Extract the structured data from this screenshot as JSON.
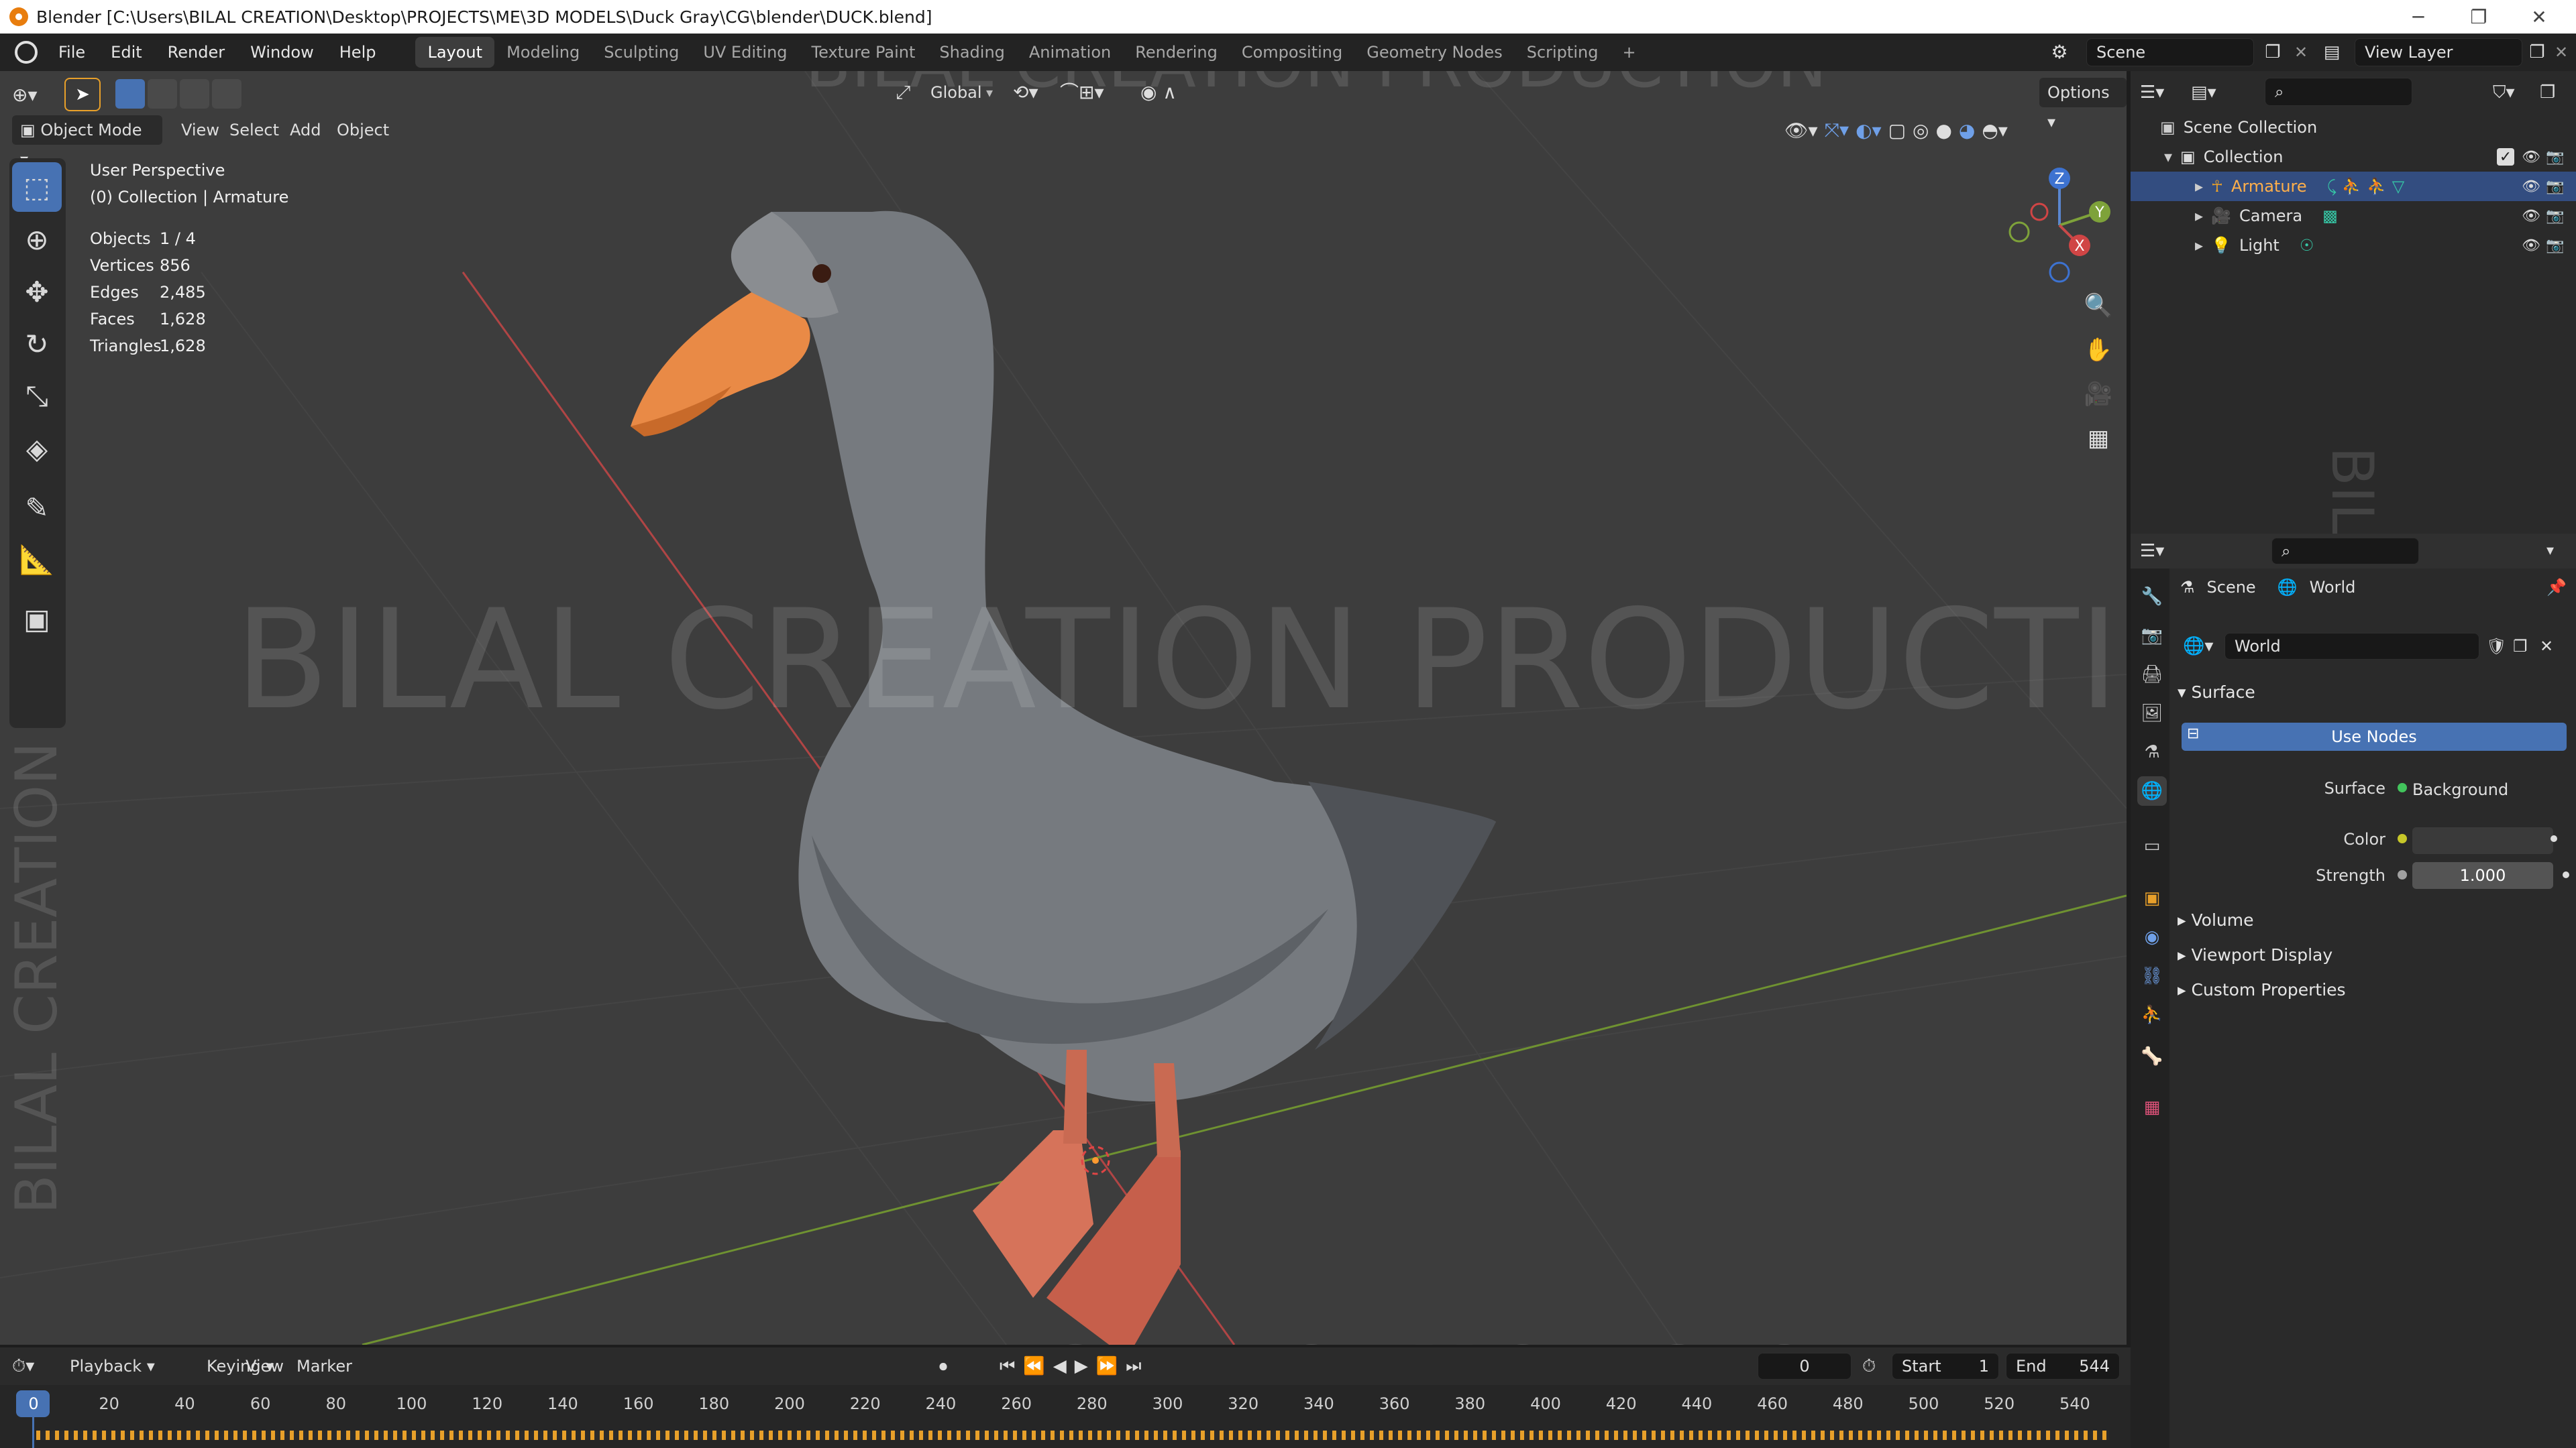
{
  "window": {
    "title": "Blender [C:\\Users\\BILAL CREATION\\Desktop\\PROJECTS\\ME\\3D MODELS\\Duck Gray\\CG\\blender\\DUCK.blend]",
    "min": "─",
    "restore": "❐",
    "close": "✕"
  },
  "menu": [
    "File",
    "Edit",
    "Render",
    "Window",
    "Help"
  ],
  "workspaces": [
    "Layout",
    "Modeling",
    "Sculpting",
    "UV Editing",
    "Texture Paint",
    "Shading",
    "Animation",
    "Rendering",
    "Compositing",
    "Geometry Nodes",
    "Scripting",
    "+"
  ],
  "scene": {
    "label": "Scene",
    "view_layer": "View Layer"
  },
  "viewport": {
    "mode": "Object Mode",
    "menus": [
      "View",
      "Select",
      "Add",
      "Object"
    ],
    "orientation": "Global",
    "options": "Options",
    "perspective": "User Perspective",
    "context": "(0) Collection | Armature",
    "stats": [
      {
        "label": "Objects",
        "value": "1 / 4"
      },
      {
        "label": "Vertices",
        "value": "856"
      },
      {
        "label": "Edges",
        "value": "2,485"
      },
      {
        "label": "Faces",
        "value": "1,628"
      },
      {
        "label": "Triangles",
        "value": "1,628"
      }
    ],
    "gizmo": {
      "z": "Z",
      "y": "Y",
      "x": "X"
    }
  },
  "outliner": {
    "root": "Scene Collection",
    "collection": "Collection",
    "items": [
      "Armature",
      "Camera",
      "Light"
    ]
  },
  "properties": {
    "breadcrumb": {
      "scene": "Scene",
      "world": "World"
    },
    "world_name": "World",
    "surface_panel": "Surface",
    "use_nodes": "Use Nodes",
    "surface_label": "Surface",
    "surface_value": "Background",
    "color_label": "Color",
    "strength_label": "Strength",
    "strength_value": "1.000",
    "panels": [
      "Volume",
      "Viewport Display",
      "Custom Properties"
    ]
  },
  "timeline": {
    "menus": [
      "Playback",
      "Keying",
      "View",
      "Marker"
    ],
    "current_frame": "0",
    "start_label": "Start",
    "start_value": "1",
    "end_label": "End",
    "end_value": "544",
    "ticks": [
      "0",
      "20",
      "40",
      "60",
      "80",
      "100",
      "120",
      "140",
      "160",
      "180",
      "200",
      "220",
      "240",
      "260",
      "280",
      "300",
      "320",
      "340",
      "360",
      "380",
      "400",
      "420",
      "440",
      "460",
      "480",
      "500",
      "520",
      "540"
    ]
  },
  "watermark": "BILAL CREATION PRODUCTION",
  "colors": {
    "accent": "#4772b3",
    "x_axis": "#c94a4a",
    "y_axis": "#7ea23a",
    "selected_row": "#334d80",
    "timeline_keys": "#e8a02a"
  }
}
